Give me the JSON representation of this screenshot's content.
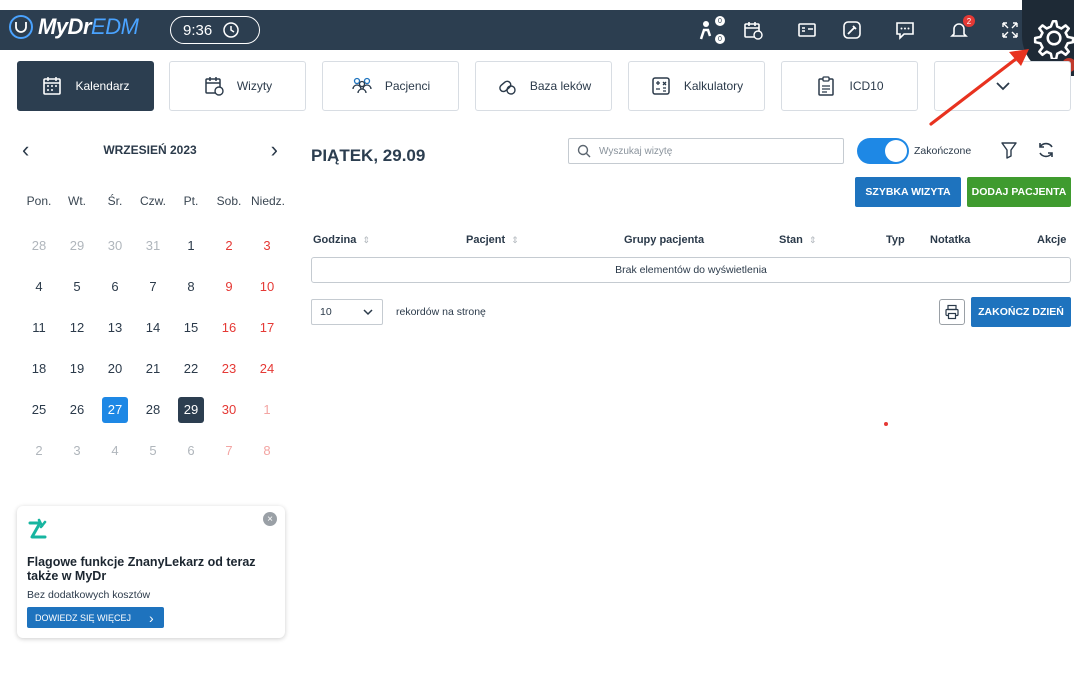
{
  "app": {
    "logo_main": "MyDr",
    "logo_accent": "EDM",
    "clock": "9:36"
  },
  "topbar": {
    "icons": [
      {
        "name": "patients-queue-icon",
        "count_top": "0",
        "count_bottom": "0"
      },
      {
        "name": "calendar-clock-icon"
      },
      {
        "name": "prescription-card-icon"
      },
      {
        "name": "tools-icon"
      },
      {
        "name": "chat-icon"
      },
      {
        "name": "notifications-icon",
        "badge": "2"
      },
      {
        "name": "fullscreen-icon"
      },
      {
        "name": "settings-gear-icon"
      }
    ]
  },
  "nav": {
    "tiles": [
      {
        "label": "Kalendarz",
        "active": true
      },
      {
        "label": "Wizyty"
      },
      {
        "label": "Pacjenci"
      },
      {
        "label": "Baza leków"
      },
      {
        "label": "Kalkulatory"
      },
      {
        "label": "ICD10"
      }
    ]
  },
  "calendar": {
    "month": "WRZESIEŃ 2023",
    "prev": "‹",
    "next": "›",
    "weekdays": [
      "Pon.",
      "Wt.",
      "Śr.",
      "Czw.",
      "Pt.",
      "Sob.",
      "Niedz."
    ],
    "weeks": [
      [
        "28",
        "29",
        "30",
        "31",
        "1",
        "2",
        "3"
      ],
      [
        "4",
        "5",
        "6",
        "7",
        "8",
        "9",
        "10"
      ],
      [
        "11",
        "12",
        "13",
        "14",
        "15",
        "16",
        "17"
      ],
      [
        "18",
        "19",
        "20",
        "21",
        "22",
        "23",
        "24"
      ],
      [
        "25",
        "26",
        "27",
        "28",
        "29",
        "30",
        "1"
      ],
      [
        "2",
        "3",
        "4",
        "5",
        "6",
        "7",
        "8"
      ]
    ]
  },
  "promo": {
    "close": "×",
    "title": "Flagowe funkcje ZnanyLekarz od teraz także w MyDr",
    "subtitle": "Bez dodatkowych kosztów",
    "button": "DOWIEDZ SIĘ WIĘCEJ",
    "button_chevron": "›"
  },
  "main": {
    "day_title": "PIĄTEK, 29.09",
    "search_placeholder": "Wyszukaj wizytę",
    "toggle_label": "Zakończone",
    "quick_visit": "SZYBKA WIZYTA",
    "add_patient": "DODAJ PACJENTA",
    "columns": {
      "godzina": "Godzina",
      "pacjent": "Pacjent",
      "grupy": "Grupy pacjenta",
      "stan": "Stan",
      "typ": "Typ",
      "notatka": "Notatka",
      "akcje": "Akcje"
    },
    "sort_glyph": "⇕",
    "empty": "Brak elementów do wyświetlenia",
    "per_page_value": "10",
    "per_page_label": "rekordów na stronę",
    "end_day": "ZAKOŃCZ DZIEŃ"
  },
  "colors": {
    "topbar": "#2c3e50",
    "primary": "#1e73be",
    "success": "#3f9b2f",
    "weekend": "#e53935",
    "today": "#1e88e5"
  }
}
